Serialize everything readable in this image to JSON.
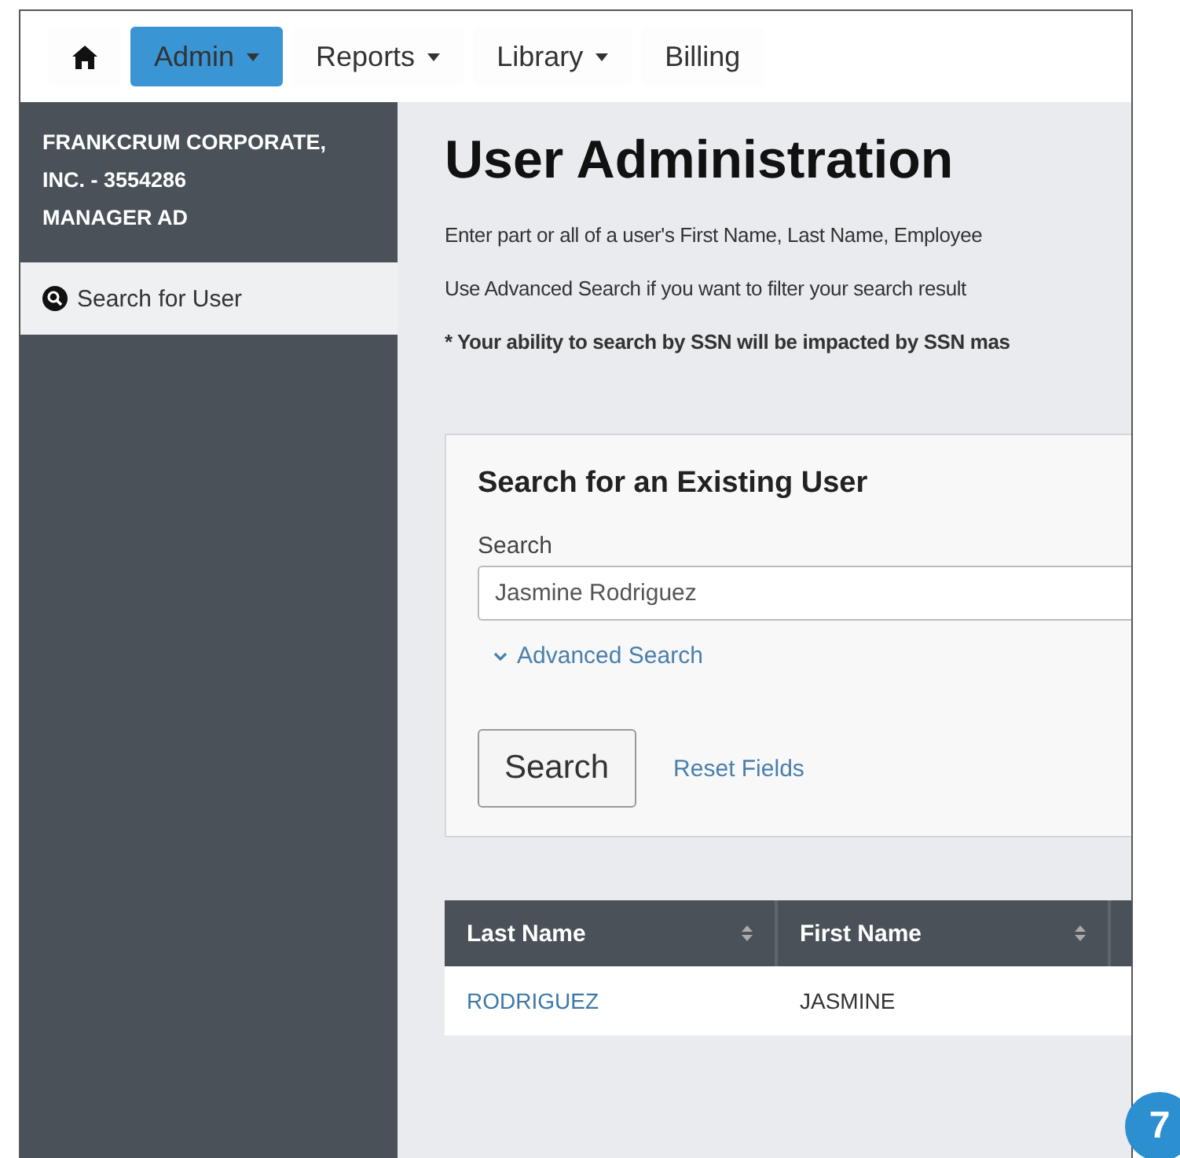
{
  "nav": {
    "items": [
      {
        "kind": "home",
        "selected": false
      },
      {
        "kind": "menu",
        "label": "Admin",
        "selected": true
      },
      {
        "kind": "menu",
        "label": "Reports",
        "selected": false
      },
      {
        "kind": "menu",
        "label": "Library",
        "selected": false
      },
      {
        "kind": "link",
        "label": "Billing",
        "selected": false
      }
    ]
  },
  "sidebar": {
    "company": [
      "FRANKCRUM CORPORATE,",
      "INC. - 3554286",
      "MANAGER AD"
    ],
    "items": [
      {
        "label": "Search for User",
        "selected": true
      }
    ]
  },
  "page": {
    "title": "User Administration",
    "notes": [
      {
        "text": "Enter part or all of a user's First Name, Last Name, Employee",
        "bold": false
      },
      {
        "text": "Use Advanced Search if you want to filter your search result",
        "bold": false
      },
      {
        "text": "* Your ability to search by SSN will be impacted by SSN mas",
        "bold": true
      }
    ]
  },
  "search_card": {
    "title": "Search for an Existing User",
    "field_label": "Search",
    "field_value": "Jasmine Rodriguez",
    "advanced": {
      "label": "Advanced Search",
      "expanded": false
    },
    "button": "Search",
    "reset": "Reset Fields"
  },
  "table": {
    "columns": [
      "Last Name",
      "First Name"
    ],
    "rows": [
      [
        "RODRIGUEZ",
        "JASMINE"
      ]
    ]
  },
  "step_badge": "7"
}
